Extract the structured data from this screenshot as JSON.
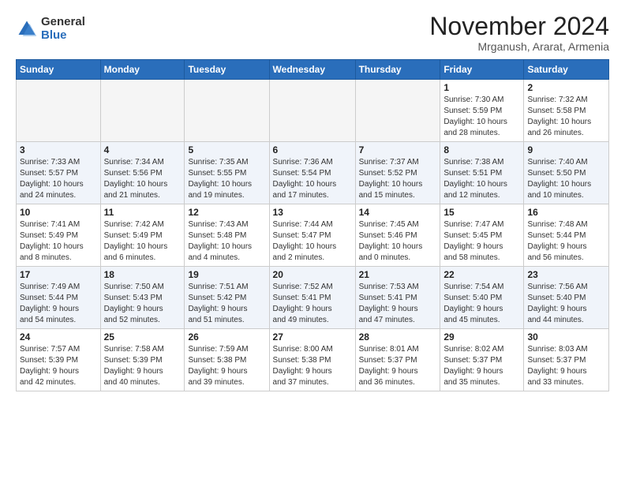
{
  "header": {
    "logo_general": "General",
    "logo_blue": "Blue",
    "month": "November 2024",
    "location": "Mrganush, Ararat, Armenia"
  },
  "weekdays": [
    "Sunday",
    "Monday",
    "Tuesday",
    "Wednesday",
    "Thursday",
    "Friday",
    "Saturday"
  ],
  "weeks": [
    [
      {
        "day": "",
        "info": ""
      },
      {
        "day": "",
        "info": ""
      },
      {
        "day": "",
        "info": ""
      },
      {
        "day": "",
        "info": ""
      },
      {
        "day": "",
        "info": ""
      },
      {
        "day": "1",
        "info": "Sunrise: 7:30 AM\nSunset: 5:59 PM\nDaylight: 10 hours\nand 28 minutes."
      },
      {
        "day": "2",
        "info": "Sunrise: 7:32 AM\nSunset: 5:58 PM\nDaylight: 10 hours\nand 26 minutes."
      }
    ],
    [
      {
        "day": "3",
        "info": "Sunrise: 7:33 AM\nSunset: 5:57 PM\nDaylight: 10 hours\nand 24 minutes."
      },
      {
        "day": "4",
        "info": "Sunrise: 7:34 AM\nSunset: 5:56 PM\nDaylight: 10 hours\nand 21 minutes."
      },
      {
        "day": "5",
        "info": "Sunrise: 7:35 AM\nSunset: 5:55 PM\nDaylight: 10 hours\nand 19 minutes."
      },
      {
        "day": "6",
        "info": "Sunrise: 7:36 AM\nSunset: 5:54 PM\nDaylight: 10 hours\nand 17 minutes."
      },
      {
        "day": "7",
        "info": "Sunrise: 7:37 AM\nSunset: 5:52 PM\nDaylight: 10 hours\nand 15 minutes."
      },
      {
        "day": "8",
        "info": "Sunrise: 7:38 AM\nSunset: 5:51 PM\nDaylight: 10 hours\nand 12 minutes."
      },
      {
        "day": "9",
        "info": "Sunrise: 7:40 AM\nSunset: 5:50 PM\nDaylight: 10 hours\nand 10 minutes."
      }
    ],
    [
      {
        "day": "10",
        "info": "Sunrise: 7:41 AM\nSunset: 5:49 PM\nDaylight: 10 hours\nand 8 minutes."
      },
      {
        "day": "11",
        "info": "Sunrise: 7:42 AM\nSunset: 5:49 PM\nDaylight: 10 hours\nand 6 minutes."
      },
      {
        "day": "12",
        "info": "Sunrise: 7:43 AM\nSunset: 5:48 PM\nDaylight: 10 hours\nand 4 minutes."
      },
      {
        "day": "13",
        "info": "Sunrise: 7:44 AM\nSunset: 5:47 PM\nDaylight: 10 hours\nand 2 minutes."
      },
      {
        "day": "14",
        "info": "Sunrise: 7:45 AM\nSunset: 5:46 PM\nDaylight: 10 hours\nand 0 minutes."
      },
      {
        "day": "15",
        "info": "Sunrise: 7:47 AM\nSunset: 5:45 PM\nDaylight: 9 hours\nand 58 minutes."
      },
      {
        "day": "16",
        "info": "Sunrise: 7:48 AM\nSunset: 5:44 PM\nDaylight: 9 hours\nand 56 minutes."
      }
    ],
    [
      {
        "day": "17",
        "info": "Sunrise: 7:49 AM\nSunset: 5:44 PM\nDaylight: 9 hours\nand 54 minutes."
      },
      {
        "day": "18",
        "info": "Sunrise: 7:50 AM\nSunset: 5:43 PM\nDaylight: 9 hours\nand 52 minutes."
      },
      {
        "day": "19",
        "info": "Sunrise: 7:51 AM\nSunset: 5:42 PM\nDaylight: 9 hours\nand 51 minutes."
      },
      {
        "day": "20",
        "info": "Sunrise: 7:52 AM\nSunset: 5:41 PM\nDaylight: 9 hours\nand 49 minutes."
      },
      {
        "day": "21",
        "info": "Sunrise: 7:53 AM\nSunset: 5:41 PM\nDaylight: 9 hours\nand 47 minutes."
      },
      {
        "day": "22",
        "info": "Sunrise: 7:54 AM\nSunset: 5:40 PM\nDaylight: 9 hours\nand 45 minutes."
      },
      {
        "day": "23",
        "info": "Sunrise: 7:56 AM\nSunset: 5:40 PM\nDaylight: 9 hours\nand 44 minutes."
      }
    ],
    [
      {
        "day": "24",
        "info": "Sunrise: 7:57 AM\nSunset: 5:39 PM\nDaylight: 9 hours\nand 42 minutes."
      },
      {
        "day": "25",
        "info": "Sunrise: 7:58 AM\nSunset: 5:39 PM\nDaylight: 9 hours\nand 40 minutes."
      },
      {
        "day": "26",
        "info": "Sunrise: 7:59 AM\nSunset: 5:38 PM\nDaylight: 9 hours\nand 39 minutes."
      },
      {
        "day": "27",
        "info": "Sunrise: 8:00 AM\nSunset: 5:38 PM\nDaylight: 9 hours\nand 37 minutes."
      },
      {
        "day": "28",
        "info": "Sunrise: 8:01 AM\nSunset: 5:37 PM\nDaylight: 9 hours\nand 36 minutes."
      },
      {
        "day": "29",
        "info": "Sunrise: 8:02 AM\nSunset: 5:37 PM\nDaylight: 9 hours\nand 35 minutes."
      },
      {
        "day": "30",
        "info": "Sunrise: 8:03 AM\nSunset: 5:37 PM\nDaylight: 9 hours\nand 33 minutes."
      }
    ]
  ]
}
